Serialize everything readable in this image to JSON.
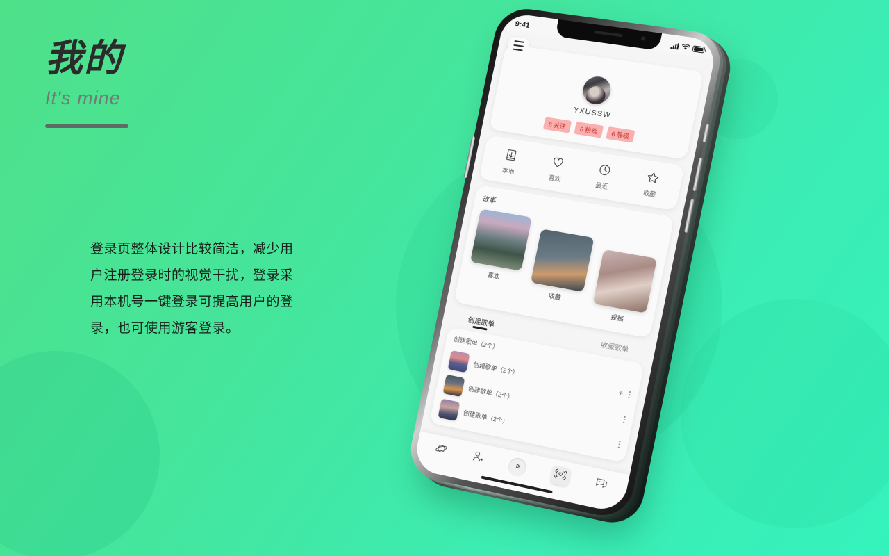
{
  "page": {
    "title": "我的",
    "subtitle": "It's mine",
    "body_copy": "登录页整体设计比较简洁，减少用户注册登录时的视觉干扰，登录采用本机号一键登录可提高用户的登录，也可使用游客登录。",
    "background_from": "#4FE089",
    "background_to": "#35F2BC"
  },
  "phone": {
    "status_bar": {
      "time": "9:41"
    },
    "menu_icon": "hamburger-icon",
    "profile": {
      "username": "YXUSSW",
      "badges": [
        {
          "label": "6 关注"
        },
        {
          "label": "6 粉丝"
        },
        {
          "label": "6 等级"
        }
      ],
      "badge_bg": "#F9B0AE",
      "badge_color": "#C0302C"
    },
    "quick_actions": [
      {
        "label": "本地",
        "icon": "download-icon"
      },
      {
        "label": "喜欢",
        "icon": "heart-icon"
      },
      {
        "label": "最近",
        "icon": "clock-icon"
      },
      {
        "label": "收藏",
        "icon": "star-icon"
      }
    ],
    "stories": {
      "section_title": "故事",
      "items": [
        {
          "label": "喜欢"
        },
        {
          "label": "收藏"
        },
        {
          "label": "投稿"
        }
      ]
    },
    "tabs": [
      {
        "label": "创建歌单",
        "active": true
      },
      {
        "label": "收藏歌单",
        "active": false
      }
    ],
    "playlists": {
      "header": "创建歌单（2个）",
      "rows": [
        {
          "label": "创建歌单（2个）",
          "has_add": true
        },
        {
          "label": "创建歌单（2个）",
          "has_add": false
        },
        {
          "label": "创建歌单（2个）",
          "has_add": false
        }
      ]
    },
    "bottom_nav": [
      {
        "icon": "planet-icon"
      },
      {
        "icon": "person-add-icon"
      },
      {
        "icon": "play-icon"
      },
      {
        "icon": "broadcast-icon"
      },
      {
        "icon": "chat-icon"
      }
    ]
  }
}
